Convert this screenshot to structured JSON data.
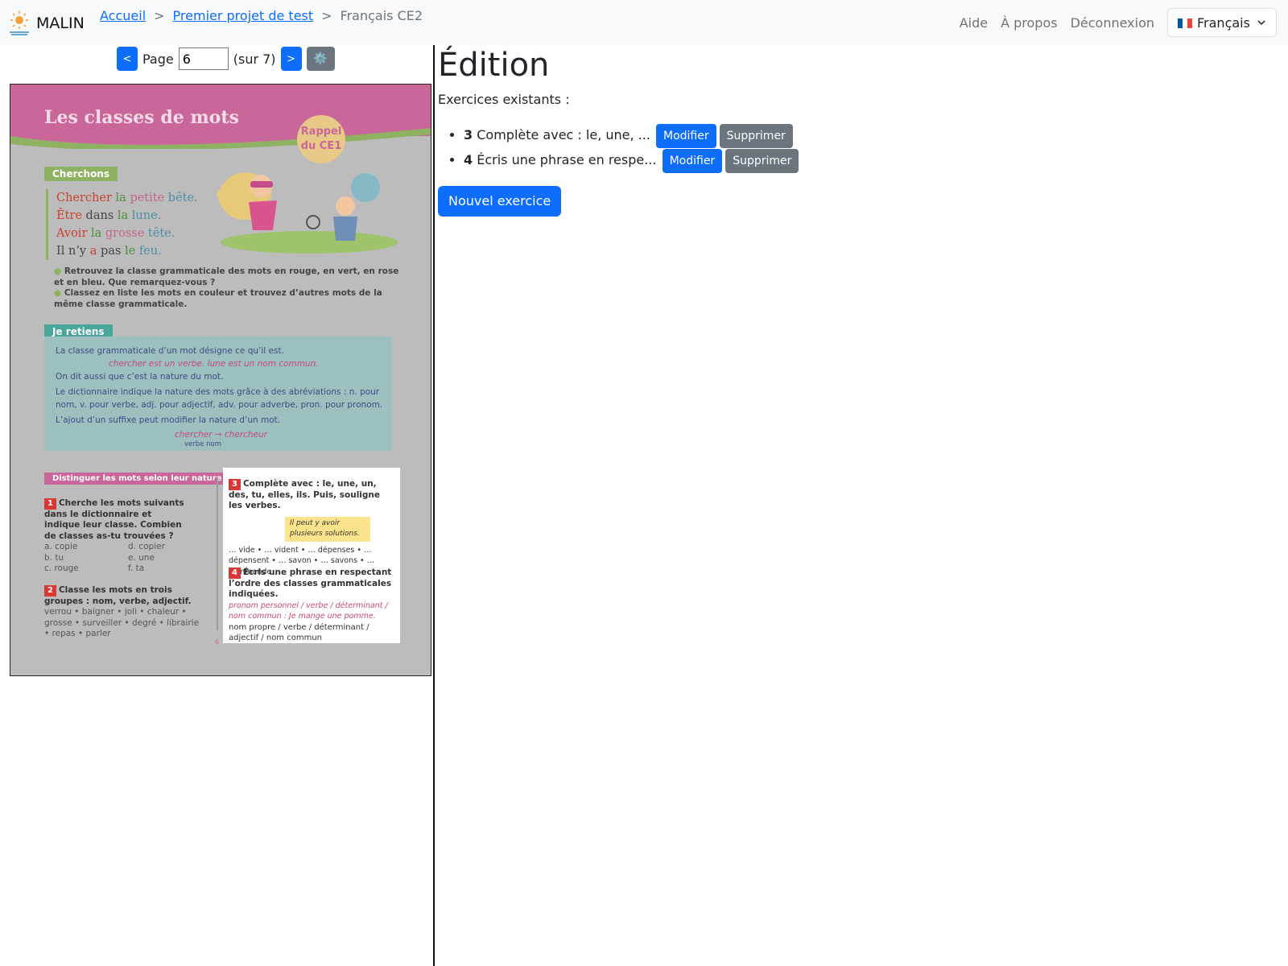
{
  "navbar": {
    "brand": "MALIN",
    "breadcrumb": [
      "Accueil",
      "Premier projet de test",
      "Français CE2"
    ],
    "breadcrumb_sep": ">",
    "links": [
      "Aide",
      "À propos",
      "Déconnexion"
    ],
    "language": "Français"
  },
  "pager": {
    "prev_label": "<",
    "next_label": ">",
    "page_label": "Page",
    "current_page": "6",
    "total_label": "(sur 7)",
    "settings_icon": "⚙️"
  },
  "textbook": {
    "title": "Les classes de mots",
    "rappel": [
      "Rappel",
      "du CE1"
    ],
    "tag_cherchons": "Cherchons",
    "poem": [
      [
        [
          "Chercher",
          "r"
        ],
        [
          "la",
          "g"
        ],
        [
          "petite",
          "p"
        ],
        [
          "bête.",
          "b"
        ]
      ],
      [
        [
          "Être",
          "r"
        ],
        [
          "dans",
          "k"
        ],
        [
          "la",
          "g"
        ],
        [
          "lune.",
          "b"
        ]
      ],
      [
        [
          "Avoir",
          "r"
        ],
        [
          "la",
          "g"
        ],
        [
          "grosse",
          "p"
        ],
        [
          "tête.",
          "b"
        ]
      ],
      [
        [
          "Il n’y",
          "k"
        ],
        [
          "a",
          "r"
        ],
        [
          "pas",
          "k"
        ],
        [
          "le",
          "g"
        ],
        [
          "feu.",
          "b"
        ]
      ]
    ],
    "instr1": "Retrouvez la classe grammaticale des mots en rouge, en vert, en rose et en bleu. Que remarquez-vous ?",
    "instr2": "Classez en liste les mots en couleur et trouvez d’autres mots de la même classe grammaticale.",
    "tag_retiens": "Je retiens",
    "retiens_1": "La classe grammaticale d’un mot désigne ce qu’il est.",
    "retiens_ex": "chercher est un verbe.        lune est un nom commun.",
    "retiens_2": "On dit aussi que c’est la nature du mot.",
    "retiens_3": "Le dictionnaire indique la nature des mots grâce à des abréviations : n. pour nom, v. pour verbe, adj. pour adjectif, adv. pour adverbe, pron. pour pronom.",
    "retiens_4": "L’ajout d’un suffixe peut modifier la nature d’un mot.",
    "retiens_suffix": "chercher → chercheur",
    "retiens_suffix_sub": "verbe                 nom",
    "tag_distinguer": "Distinguer les mots selon leur nature",
    "exo1_title": "Cherche les mots suivants dans le dictionnaire et indique leur classe. Combien de classes as-tu trouvées ?",
    "exo1_items": [
      "a. copie",
      "d. copier",
      "b. tu",
      "e. une",
      "c. rouge",
      "f. ta"
    ],
    "exo2_title": "Classe les mots en trois groupes : nom, verbe, adjectif.",
    "exo2_words": "verrou • baigner • joli • chaleur • grosse • surveiller • degré • librairie • repas • parler",
    "exo3_title": "Complète avec : le, une, un, des, tu, elles, ils. Puis, souligne les verbes.",
    "exo3_bubble": "Il peut y avoir plusieurs solutions.",
    "exo3_words": "… vide • … vident • … dépenses • … dépensent • … savon • … savons • … commande",
    "exo4_title": "Écris une phrase en respectant l’ordre des classes grammaticales indiquées.",
    "exo4_example": "pronom personnel / verbe / déterminant / nom commun : Je mange une pomme.",
    "exo4_task": "nom propre / verbe / déterminant / adjectif / nom commun",
    "page_number": "6"
  },
  "editor": {
    "title": "Édition",
    "existing_label": "Exercices existants :",
    "exercises": [
      {
        "number": "3",
        "text": "Complète avec : le, une, ..."
      },
      {
        "number": "4",
        "text": "Écris une phrase en respe..."
      }
    ],
    "modify_label": "Modifier",
    "delete_label": "Supprimer",
    "new_label": "Nouvel exercice"
  },
  "colors": {
    "primary": "#0d6efd",
    "secondary": "#6c757d",
    "book_pink": "#c9679a",
    "book_green": "#8fb262",
    "book_teal": "#4aa59a"
  }
}
